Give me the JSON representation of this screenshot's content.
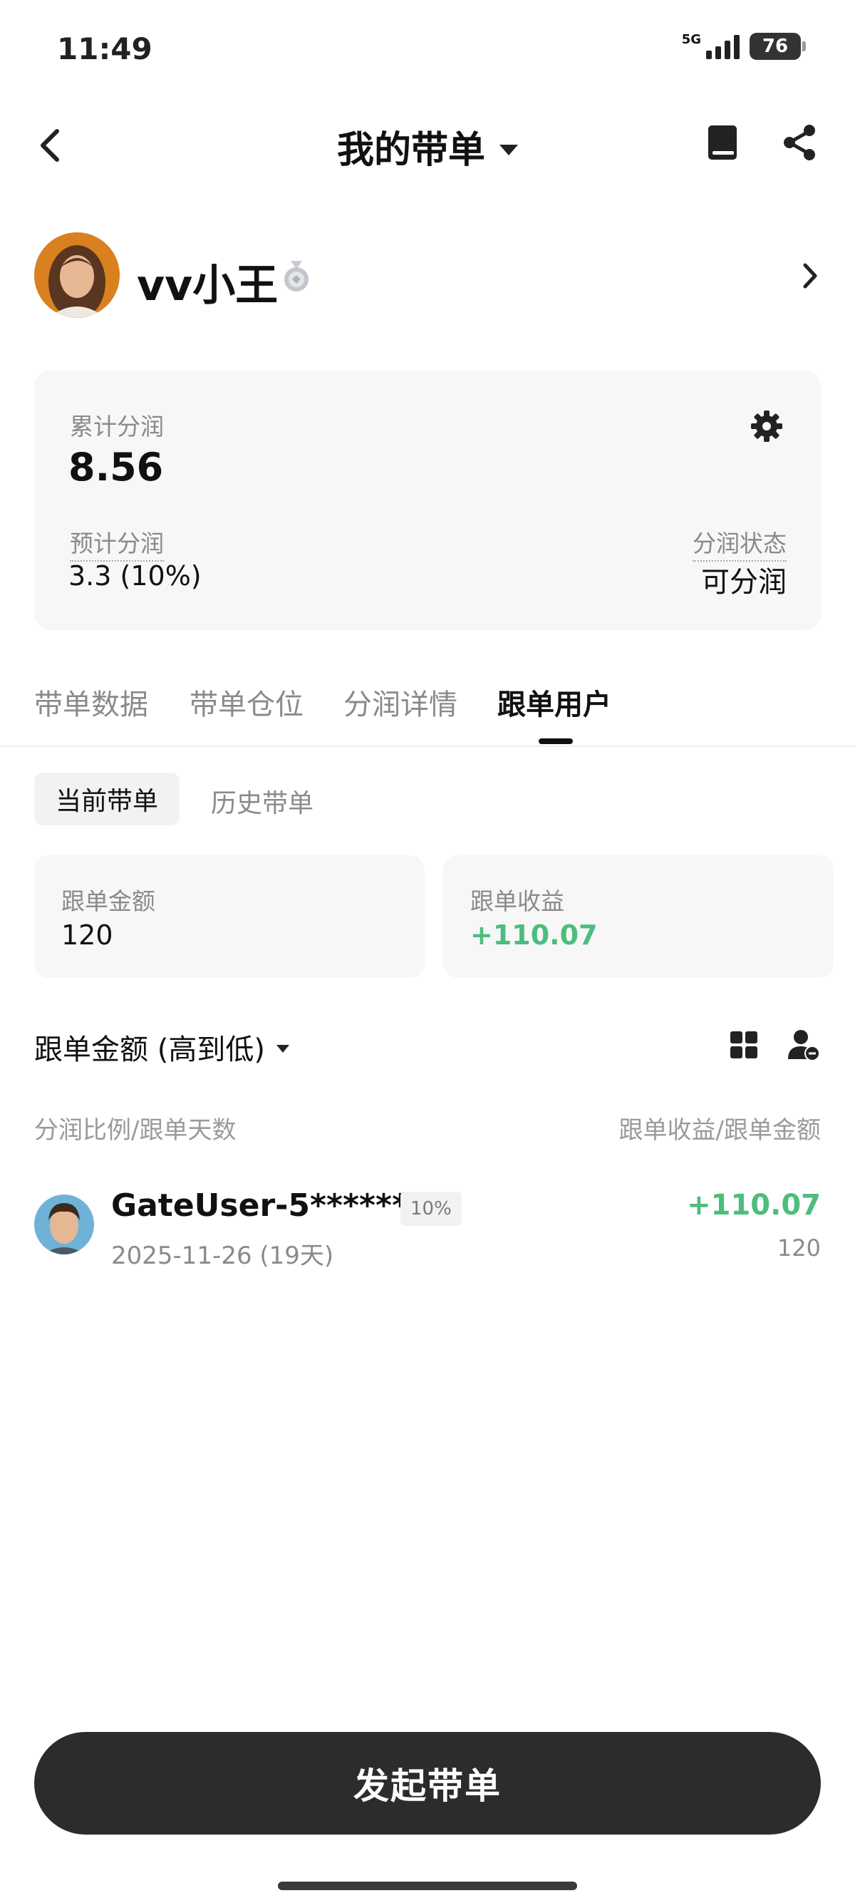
{
  "status_bar": {
    "time": "11:49",
    "network": "5G",
    "battery": "76"
  },
  "nav": {
    "title": "我的带单"
  },
  "profile": {
    "name": "vv小王"
  },
  "earnings": {
    "cumulative_label": "累计分润",
    "cumulative_value": "8.56",
    "estimated_label": "预计分润",
    "estimated_value": "3.3 (10%)",
    "status_label": "分润状态",
    "status_value": "可分润"
  },
  "tabs": [
    {
      "label": "带单数据",
      "active": false
    },
    {
      "label": "带单仓位",
      "active": false
    },
    {
      "label": "分润详情",
      "active": false
    },
    {
      "label": "跟单用户",
      "active": true
    }
  ],
  "subtabs": [
    {
      "label": "当前带单",
      "active": true
    },
    {
      "label": "历史带单",
      "active": false
    }
  ],
  "stats": {
    "amount_label": "跟单金额",
    "amount_value": "120",
    "profit_label": "跟单收益",
    "profit_value": "+110.07"
  },
  "sort": {
    "label": "跟单金额 (高到低)"
  },
  "columns": {
    "left": "分润比例/跟单天数",
    "right": "跟单收益/跟单金额"
  },
  "followers": [
    {
      "name": "GateUser-5******0",
      "badge": "10%",
      "date": "2025-11-26 (19天)",
      "profit": "+110.07",
      "amount": "120"
    }
  ],
  "cta": {
    "label": "发起带单"
  },
  "colors": {
    "profit_green": "#4cbd7c",
    "cta_bg": "#2b2c2e",
    "card_bg": "#f7f7f8"
  },
  "icons": [
    "back-chevron-icon",
    "dropdown-caret-icon",
    "book-icon",
    "share-icon",
    "medal-icon",
    "chevron-right-icon",
    "gear-icon",
    "grid-view-icon",
    "user-remove-icon"
  ]
}
